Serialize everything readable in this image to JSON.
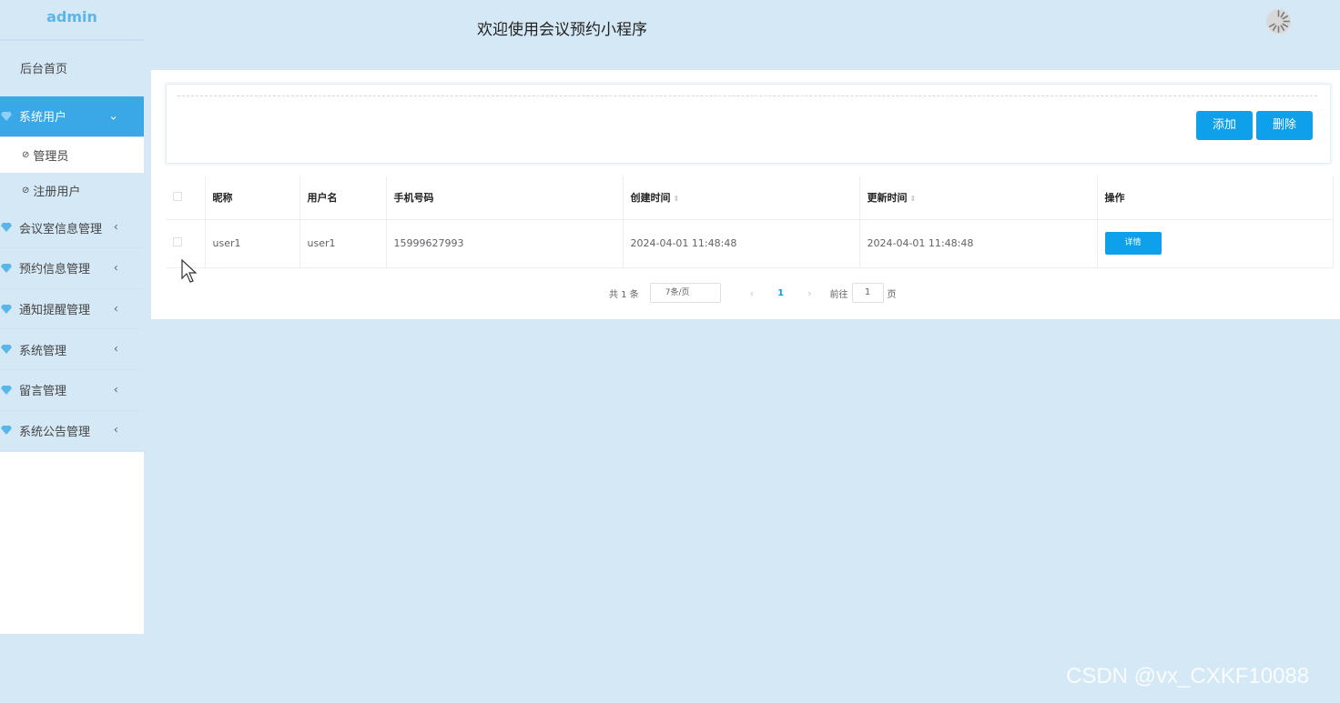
{
  "app": {
    "brand": "admin",
    "header_title": "欢迎使用会议预约小程序"
  },
  "sidebar": {
    "home": "后台首页",
    "groups": [
      {
        "label": "系统用户",
        "expanded": true,
        "children": [
          "管理员",
          "注册用户"
        ]
      },
      {
        "label": "会议室信息管理"
      },
      {
        "label": "预约信息管理"
      },
      {
        "label": "通知提醒管理"
      },
      {
        "label": "系统管理"
      },
      {
        "label": "留言管理"
      },
      {
        "label": "系统公告管理"
      }
    ],
    "selected_child": "管理员"
  },
  "toolbar": {
    "add_label": "添加",
    "delete_label": "删除"
  },
  "table": {
    "columns": [
      "昵称",
      "用户名",
      "手机号码",
      "创建时间",
      "更新时间",
      "操作"
    ],
    "rows": [
      {
        "nickname": "user1",
        "username": "user1",
        "phone": "15999627993",
        "created": "2024-04-01 11:48:48",
        "updated": "2024-04-01 11:48:48",
        "action": "详情"
      }
    ]
  },
  "pagination": {
    "total_text": "共 1 条",
    "page_size": "7条/页",
    "prev": "‹",
    "current_page": "1",
    "next": "›",
    "goto_label": "前往",
    "goto_value": "1",
    "page_suffix": "页"
  },
  "icons": {
    "menu_group": "gem-icon",
    "sub_item": "clock-icon",
    "loading": "spinner-icon",
    "sort": "sort-icon"
  },
  "colors": {
    "accent": "#0ea0ea",
    "active_menu": "#3aa7e6",
    "background": "#d5e8f6"
  },
  "watermark": "CSDN @vx_CXKF10088"
}
